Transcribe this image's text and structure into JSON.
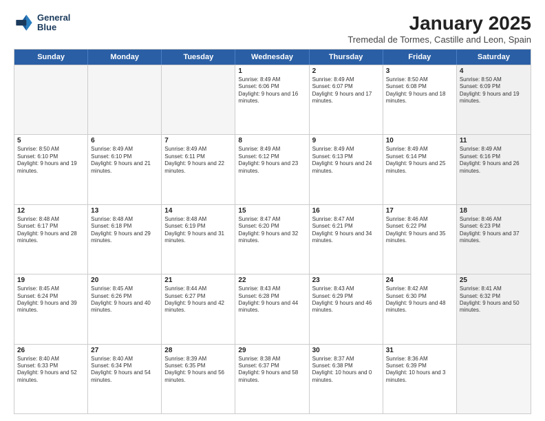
{
  "logo": {
    "line1": "General",
    "line2": "Blue"
  },
  "title": "January 2025",
  "location": "Tremedal de Tormes, Castille and Leon, Spain",
  "days_of_week": [
    "Sunday",
    "Monday",
    "Tuesday",
    "Wednesday",
    "Thursday",
    "Friday",
    "Saturday"
  ],
  "rows": [
    [
      {
        "day": "",
        "text": "",
        "empty": true
      },
      {
        "day": "",
        "text": "",
        "empty": true
      },
      {
        "day": "",
        "text": "",
        "empty": true
      },
      {
        "day": "1",
        "text": "Sunrise: 8:49 AM\nSunset: 6:06 PM\nDaylight: 9 hours and 16 minutes."
      },
      {
        "day": "2",
        "text": "Sunrise: 8:49 AM\nSunset: 6:07 PM\nDaylight: 9 hours and 17 minutes."
      },
      {
        "day": "3",
        "text": "Sunrise: 8:50 AM\nSunset: 6:08 PM\nDaylight: 9 hours and 18 minutes."
      },
      {
        "day": "4",
        "text": "Sunrise: 8:50 AM\nSunset: 6:09 PM\nDaylight: 9 hours and 19 minutes.",
        "shaded": true
      }
    ],
    [
      {
        "day": "5",
        "text": "Sunrise: 8:50 AM\nSunset: 6:10 PM\nDaylight: 9 hours and 19 minutes."
      },
      {
        "day": "6",
        "text": "Sunrise: 8:49 AM\nSunset: 6:10 PM\nDaylight: 9 hours and 21 minutes."
      },
      {
        "day": "7",
        "text": "Sunrise: 8:49 AM\nSunset: 6:11 PM\nDaylight: 9 hours and 22 minutes."
      },
      {
        "day": "8",
        "text": "Sunrise: 8:49 AM\nSunset: 6:12 PM\nDaylight: 9 hours and 23 minutes."
      },
      {
        "day": "9",
        "text": "Sunrise: 8:49 AM\nSunset: 6:13 PM\nDaylight: 9 hours and 24 minutes."
      },
      {
        "day": "10",
        "text": "Sunrise: 8:49 AM\nSunset: 6:14 PM\nDaylight: 9 hours and 25 minutes."
      },
      {
        "day": "11",
        "text": "Sunrise: 8:49 AM\nSunset: 6:16 PM\nDaylight: 9 hours and 26 minutes.",
        "shaded": true
      }
    ],
    [
      {
        "day": "12",
        "text": "Sunrise: 8:48 AM\nSunset: 6:17 PM\nDaylight: 9 hours and 28 minutes."
      },
      {
        "day": "13",
        "text": "Sunrise: 8:48 AM\nSunset: 6:18 PM\nDaylight: 9 hours and 29 minutes."
      },
      {
        "day": "14",
        "text": "Sunrise: 8:48 AM\nSunset: 6:19 PM\nDaylight: 9 hours and 31 minutes."
      },
      {
        "day": "15",
        "text": "Sunrise: 8:47 AM\nSunset: 6:20 PM\nDaylight: 9 hours and 32 minutes."
      },
      {
        "day": "16",
        "text": "Sunrise: 8:47 AM\nSunset: 6:21 PM\nDaylight: 9 hours and 34 minutes."
      },
      {
        "day": "17",
        "text": "Sunrise: 8:46 AM\nSunset: 6:22 PM\nDaylight: 9 hours and 35 minutes."
      },
      {
        "day": "18",
        "text": "Sunrise: 8:46 AM\nSunset: 6:23 PM\nDaylight: 9 hours and 37 minutes.",
        "shaded": true
      }
    ],
    [
      {
        "day": "19",
        "text": "Sunrise: 8:45 AM\nSunset: 6:24 PM\nDaylight: 9 hours and 39 minutes."
      },
      {
        "day": "20",
        "text": "Sunrise: 8:45 AM\nSunset: 6:26 PM\nDaylight: 9 hours and 40 minutes."
      },
      {
        "day": "21",
        "text": "Sunrise: 8:44 AM\nSunset: 6:27 PM\nDaylight: 9 hours and 42 minutes."
      },
      {
        "day": "22",
        "text": "Sunrise: 8:43 AM\nSunset: 6:28 PM\nDaylight: 9 hours and 44 minutes."
      },
      {
        "day": "23",
        "text": "Sunrise: 8:43 AM\nSunset: 6:29 PM\nDaylight: 9 hours and 46 minutes."
      },
      {
        "day": "24",
        "text": "Sunrise: 8:42 AM\nSunset: 6:30 PM\nDaylight: 9 hours and 48 minutes."
      },
      {
        "day": "25",
        "text": "Sunrise: 8:41 AM\nSunset: 6:32 PM\nDaylight: 9 hours and 50 minutes.",
        "shaded": true
      }
    ],
    [
      {
        "day": "26",
        "text": "Sunrise: 8:40 AM\nSunset: 6:33 PM\nDaylight: 9 hours and 52 minutes."
      },
      {
        "day": "27",
        "text": "Sunrise: 8:40 AM\nSunset: 6:34 PM\nDaylight: 9 hours and 54 minutes."
      },
      {
        "day": "28",
        "text": "Sunrise: 8:39 AM\nSunset: 6:35 PM\nDaylight: 9 hours and 56 minutes."
      },
      {
        "day": "29",
        "text": "Sunrise: 8:38 AM\nSunset: 6:37 PM\nDaylight: 9 hours and 58 minutes."
      },
      {
        "day": "30",
        "text": "Sunrise: 8:37 AM\nSunset: 6:38 PM\nDaylight: 10 hours and 0 minutes."
      },
      {
        "day": "31",
        "text": "Sunrise: 8:36 AM\nSunset: 6:39 PM\nDaylight: 10 hours and 3 minutes."
      },
      {
        "day": "",
        "text": "",
        "empty": true
      }
    ]
  ]
}
